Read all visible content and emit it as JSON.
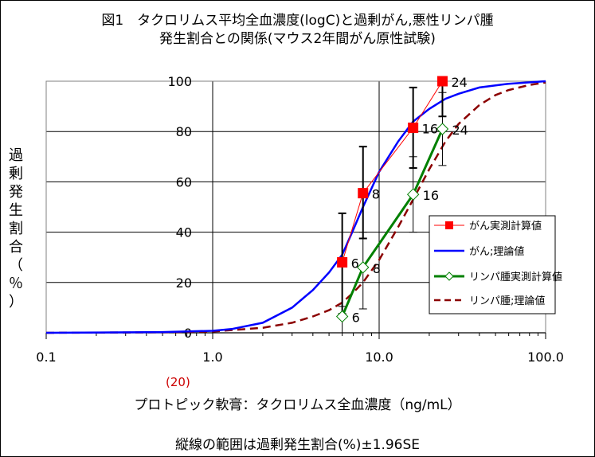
{
  "chart_data": {
    "type": "line",
    "title_line1": "図1　タクロリムス平均全血濃度(logC)と過剰がん,悪性リンパ腫",
    "title_line2": "発生割合との関係(マウス2年間がん原性試験)",
    "xlabel": "プロトピック軟膏：タクロリムス全血濃度（ng/mL）",
    "ylabel_chars": [
      "過",
      "剰",
      "発",
      "生",
      "割",
      "合",
      "（",
      "％",
      "）"
    ],
    "note": "縦線の範囲は過剰発生割合(%)±1.96SE",
    "annotation_20": "(20)",
    "x_scale": "log",
    "xlim": [
      0.1,
      100
    ],
    "ylim": [
      0,
      100
    ],
    "x_ticks": [
      0.1,
      1,
      10,
      100
    ],
    "x_tick_labels": [
      "0.1",
      "1.0",
      "10.0",
      "100.0"
    ],
    "y_ticks": [
      0,
      20,
      40,
      60,
      80,
      100
    ],
    "y_tick_labels": [
      "0",
      "20",
      "40",
      "60",
      "80",
      "100"
    ],
    "grid": "horizontal + vertical at decades",
    "legend_position": "right",
    "series": [
      {
        "name": "がん実測計算値",
        "color": "#ff0000",
        "marker": "square",
        "style": "thin-line",
        "x": [
          6.0,
          8.0,
          16.0,
          24.0
        ],
        "y": [
          28,
          55.5,
          81.5,
          100
        ],
        "err_low": [
          7.5,
          37.5,
          65.5,
          86
        ],
        "err_high": [
          47.5,
          74,
          97.5,
          100
        ],
        "point_labels": [
          "6",
          "8",
          "16",
          "24"
        ]
      },
      {
        "name": "がん;理論値",
        "color": "#0000ff",
        "marker": "none",
        "style": "solid",
        "x": [
          0.1,
          0.5,
          1.0,
          1.3,
          2.0,
          3.0,
          4.0,
          5.0,
          6.0,
          7.0,
          8.0,
          10.0,
          13.0,
          16.0,
          20.0,
          25.0,
          30.0,
          40.0,
          60.0,
          100.0
        ],
        "y": [
          0,
          0.3,
          0.8,
          1.5,
          4,
          10,
          17,
          24,
          31,
          41,
          50,
          64,
          76,
          84,
          89,
          93,
          95,
          97.5,
          99,
          100
        ]
      },
      {
        "name": "リンパ腫実測計算値",
        "color": "#008000",
        "marker": "diamond",
        "style": "thick-line",
        "x": [
          6.0,
          8.0,
          16.0,
          24.0
        ],
        "y": [
          6.5,
          26,
          55,
          81
        ],
        "err_low": [
          0,
          9.5,
          40,
          66.5
        ],
        "err_high": [
          10.5,
          40,
          70,
          95.5
        ],
        "point_labels": [
          "6",
          "8",
          "16",
          "24"
        ]
      },
      {
        "name": "リンパ腫;理論値",
        "color": "#8b0000",
        "marker": "none",
        "style": "dashed",
        "x": [
          0.1,
          0.5,
          1.0,
          2.0,
          3.0,
          4.0,
          5.0,
          6.0,
          7.0,
          8.0,
          10.0,
          13.0,
          16.0,
          20.0,
          25.0,
          30.0,
          40.0,
          50.0,
          60.0,
          80.0,
          100.0
        ],
        "y": [
          0,
          0.2,
          0.5,
          2,
          4,
          6.5,
          9,
          12,
          16,
          20,
          29,
          42,
          53,
          65,
          76,
          83,
          90.5,
          94.5,
          96.5,
          98.5,
          99.5
        ]
      }
    ]
  }
}
